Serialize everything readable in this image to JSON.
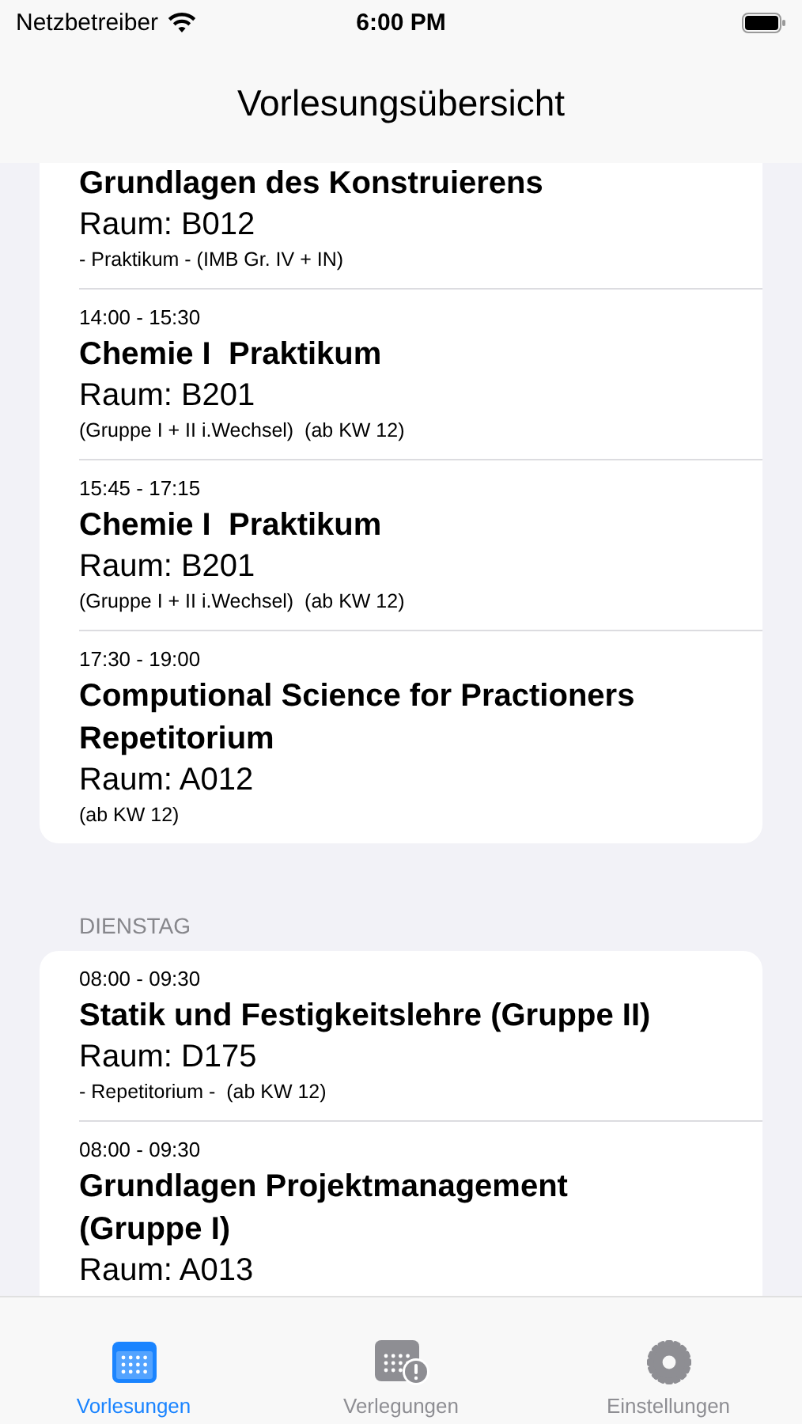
{
  "status_bar": {
    "carrier": "Netzbetreiber",
    "time": "6:00 PM"
  },
  "nav": {
    "title": "Vorlesungsübersicht"
  },
  "sections": [
    {
      "items": [
        {
          "title": "Grundlagen des Konstruierens",
          "room": "Raum: B012",
          "note": "- Praktikum - (IMB Gr. IV + IN)"
        },
        {
          "time": "14:00 - 15:30",
          "title": "Chemie I  Praktikum",
          "room": "Raum: B201",
          "note": "(Gruppe I + II i.Wechsel)  (ab KW 12)"
        },
        {
          "time": "15:45 - 17:15",
          "title": "Chemie I  Praktikum",
          "room": "Raum: B201",
          "note": "(Gruppe I + II i.Wechsel)  (ab KW 12)"
        },
        {
          "time": "17:30 - 19:00",
          "title": "Computional Science for Practioners Repetitorium",
          "room": "Raum: A012",
          "note": "(ab KW 12)"
        }
      ]
    },
    {
      "header": "DIENSTAG",
      "items": [
        {
          "time": "08:00 - 09:30",
          "title": "Statik und Festigkeitslehre (Gruppe II)",
          "room": "Raum: D175",
          "note": "- Repetitorium -  (ab KW 12)"
        },
        {
          "time": "08:00 - 09:30",
          "title": "Grundlagen Projektmanagement (Gruppe I)",
          "room": "Raum: A013"
        }
      ]
    }
  ],
  "tabs": [
    {
      "label": "Vorlesungen",
      "kind": "calendar",
      "selected": true
    },
    {
      "label": "Verlegungen",
      "kind": "alert",
      "selected": false
    },
    {
      "label": "Einstellungen",
      "kind": "settings",
      "selected": false
    }
  ]
}
